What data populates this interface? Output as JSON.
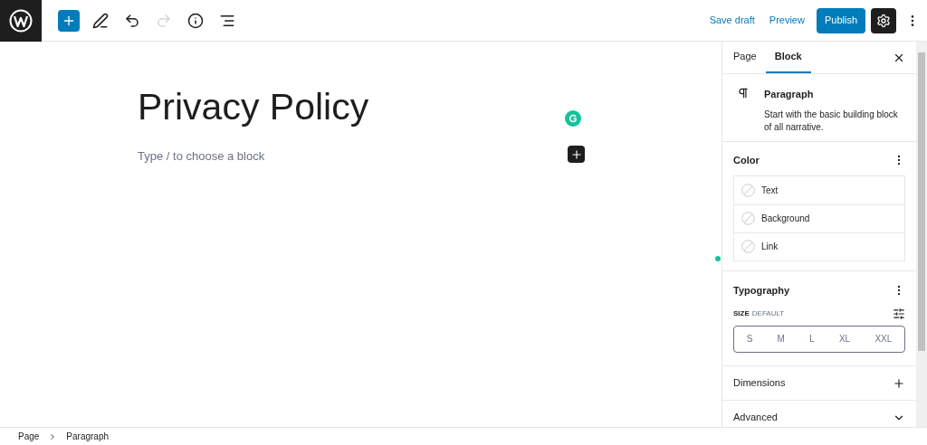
{
  "toolbar": {
    "tools": [
      {
        "kind": "inserter",
        "disabled": false
      },
      {
        "kind": "tools",
        "disabled": false
      },
      {
        "kind": "undo",
        "disabled": false
      },
      {
        "kind": "redo",
        "disabled": true
      },
      {
        "kind": "details",
        "disabled": false
      },
      {
        "kind": "list",
        "disabled": false
      }
    ],
    "save_draft": "Save draft",
    "preview": "Preview",
    "publish": "Publish"
  },
  "editor": {
    "title": "Privacy Policy",
    "placeholder": "Type / to choose a block"
  },
  "sidebar": {
    "tabs": [
      {
        "label": "Page",
        "selected": false
      },
      {
        "label": "Block",
        "selected": true
      }
    ],
    "block": {
      "name": "Paragraph",
      "description": "Start with the basic building block of all narrative."
    },
    "color": {
      "title": "Color",
      "items": [
        "Text",
        "Background",
        "Link"
      ]
    },
    "typography": {
      "title": "Typography",
      "size_label": "SIZE",
      "size_value": "DEFAULT",
      "sizes": [
        {
          "label": "S",
          "selected": false
        },
        {
          "label": "M",
          "selected": false
        },
        {
          "label": "L",
          "selected": false
        },
        {
          "label": "XL",
          "selected": false
        },
        {
          "label": "XXL",
          "selected": false
        }
      ]
    },
    "panels": [
      {
        "title": "Dimensions",
        "kind": "add"
      },
      {
        "title": "Advanced",
        "kind": "collapse"
      }
    ]
  },
  "breadcrumb": [
    "Page",
    "Paragraph"
  ]
}
